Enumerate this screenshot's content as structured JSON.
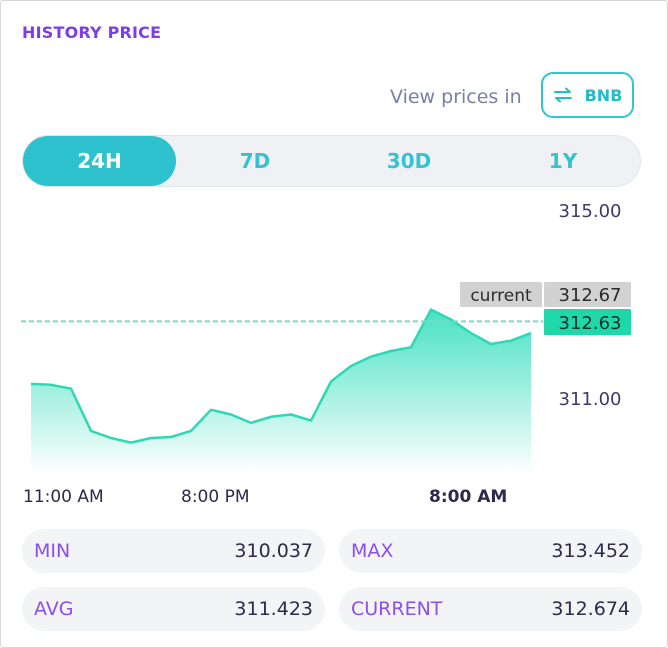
{
  "header": {
    "title": "HISTORY PRICE"
  },
  "view_prices": {
    "label": "View prices in",
    "currency": "BNB",
    "icon": "swap-arrows-icon"
  },
  "tabs": [
    {
      "label": "24H",
      "active": true
    },
    {
      "label": "7D",
      "active": false
    },
    {
      "label": "30D",
      "active": false
    },
    {
      "label": "1Y",
      "active": false
    }
  ],
  "chart_data": {
    "type": "area",
    "x_labels": [
      "11:00 AM",
      "8:00 PM",
      "8:00 AM"
    ],
    "y_ticks": [
      315.0,
      311.0
    ],
    "y_tick_labels": [
      "315.00",
      "311.00"
    ],
    "ylim": [
      309.4,
      315.0
    ],
    "values": [
      311.3,
      311.28,
      311.2,
      310.3,
      310.15,
      310.05,
      310.15,
      310.17,
      310.3,
      310.75,
      310.65,
      310.47,
      310.6,
      310.65,
      310.52,
      311.35,
      311.68,
      311.88,
      312.0,
      312.08,
      312.88,
      312.67,
      312.38,
      312.15,
      312.22,
      312.38
    ],
    "current_label": "current",
    "current_value": "312.67",
    "reference_value": "312.63",
    "reference_level": 312.63,
    "fill_color": "#3ee0bf",
    "line_color": "#2ed8b5",
    "current_badge_color": "#d2d2d2",
    "reference_badge_color": "#1fd8aa"
  },
  "stats": [
    {
      "label": "MIN",
      "value": "310.037"
    },
    {
      "label": "MAX",
      "value": "313.452"
    },
    {
      "label": "AVG",
      "value": "311.423"
    },
    {
      "label": "CURRENT",
      "value": "312.674"
    }
  ]
}
